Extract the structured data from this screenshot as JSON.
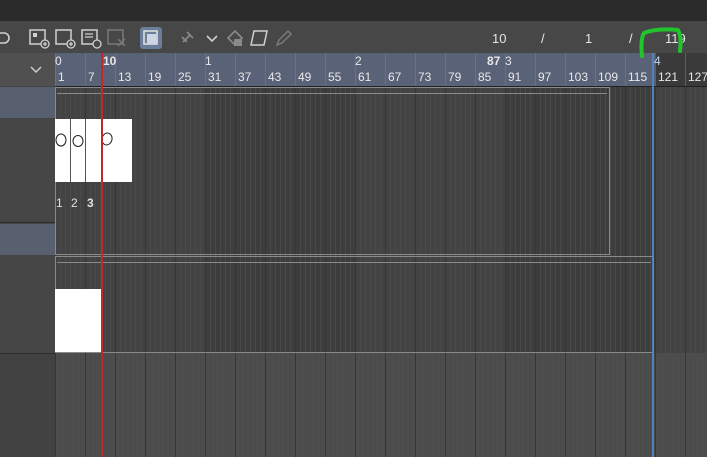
{
  "toolbar": {
    "buttons": [
      {
        "name": "new-animation-folder-icon"
      },
      {
        "name": "new-animation-cel-icon"
      },
      {
        "name": "new-folder-cel-icon"
      },
      {
        "name": "specify-cel-disabled-icon"
      },
      {
        "name": "enable-onion-skin-icon"
      },
      {
        "name": "link-off-icon"
      },
      {
        "name": "dropdown-chevron-icon"
      },
      {
        "name": "camera-key-icon"
      },
      {
        "name": "paper-icon"
      },
      {
        "name": "pen-disabled-icon"
      }
    ],
    "current_frame": "10",
    "sep1": "/",
    "frame_b": "1",
    "sep2": "/",
    "end_frame": "119"
  },
  "ruler": {
    "seconds": [
      "0",
      "1",
      "2",
      "3"
    ],
    "current_marker": "10",
    "mark_87": "87",
    "end_marker": "4",
    "frames": [
      "1",
      "7",
      "13",
      "19",
      "25",
      "31",
      "37",
      "43",
      "49",
      "55",
      "61",
      "67",
      "73",
      "79",
      "85",
      "91",
      "97",
      "103",
      "109",
      "115",
      "121",
      "127"
    ]
  },
  "tracks": {
    "cel_numbers": [
      "1",
      "2",
      "3"
    ]
  },
  "colors": {
    "playhead": "#c2282a",
    "end_marker": "#4f87c9",
    "range_highlight": "#5a6277",
    "annotation": "#22c42e"
  }
}
